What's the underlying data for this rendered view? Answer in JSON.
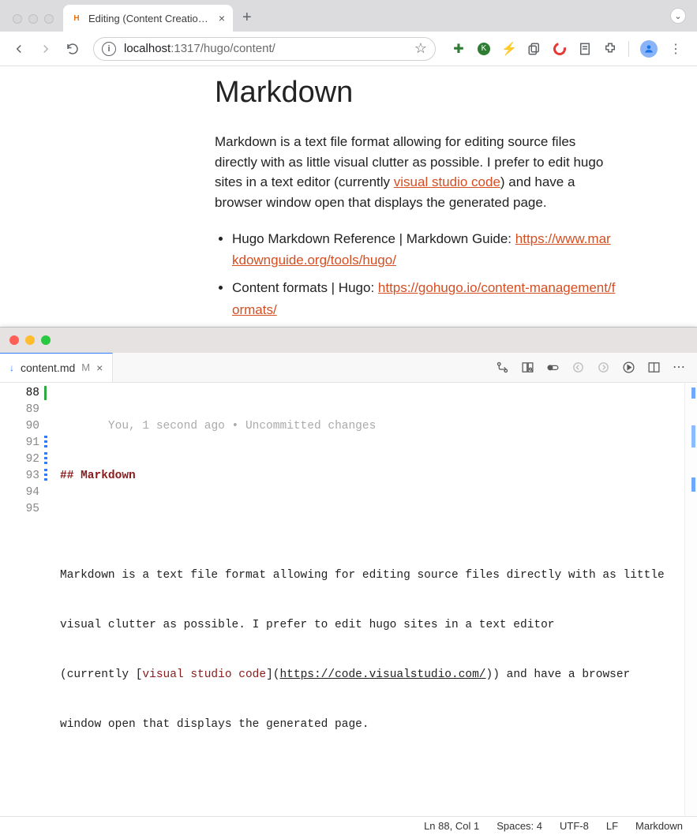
{
  "browser": {
    "tab": {
      "favicon_letter": "H",
      "title": "Editing (Content Creation) - A",
      "close_glyph": "×"
    },
    "newtab_glyph": "+",
    "url": {
      "host": "localhost",
      "port": ":1317",
      "path": "/hugo/content/"
    }
  },
  "page": {
    "heading": "Markdown",
    "para_before_link": "Markdown is a text file format allowing for editing source files directly with as little visual clutter as possible. I prefer to edit hugo sites in a text editor (currently ",
    "link_text": "visual studio code",
    "para_after_link": ") and have a browser window open that displays the generated page.",
    "items": [
      {
        "text": "Hugo Markdown Reference | Markdown Guide: ",
        "link": "https://www.markdownguide.org/tools/hugo/"
      },
      {
        "text": "Content formats | Hugo: ",
        "link": "https://gohugo.io/content-management/formats/"
      }
    ]
  },
  "editor": {
    "tab": {
      "filename": "content.md",
      "modified": "M",
      "close_glyph": "×"
    },
    "lines": {
      "start": 88,
      "blame": "You, 1 second ago • Uncommitted changes",
      "l89": "## Markdown",
      "l91a": "Markdown is a text file format allowing for editing source files directly with as little",
      "l92a": "visual clutter as possible. I prefer to edit hugo sites in a text editor",
      "l93_pre": "(currently [",
      "l93_link": "visual studio code",
      "l93_mid": "](",
      "l93_url": "https://code.visualstudio.com/",
      "l93_post": ")) and have a browser",
      "l94a": "window open that displays the generated page."
    },
    "status": {
      "pos": "Ln 88, Col 1",
      "spaces": "Spaces: 4",
      "enc": "UTF-8",
      "eol": "LF",
      "lang": "Markdown"
    }
  }
}
